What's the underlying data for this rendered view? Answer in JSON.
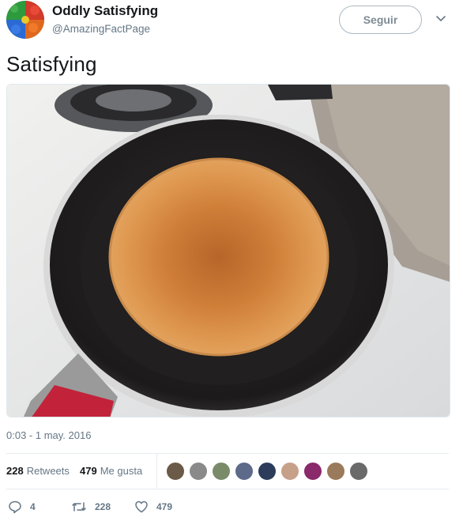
{
  "header": {
    "display_name": "Oddly Satisfying",
    "handle": "@AmazingFactPage",
    "follow_label": "Seguir",
    "avatar_icon": "colorful-candy-avatar",
    "menu_icon": "chevron-down-icon"
  },
  "tweet": {
    "text": "Satisfying",
    "media_description_icon": "pancake-in-pan-image",
    "timestamp": "0:03 - 1 may. 2016"
  },
  "stats": {
    "retweets_count": "228",
    "retweets_label": "Retweets",
    "likes_count": "479",
    "likes_label": "Me gusta",
    "liker_avatars": [
      "#6b5a48",
      "#8a8a8a",
      "#7a8b6a",
      "#5d6a8a",
      "#2c3c5a",
      "#c7a08a",
      "#8a2a6a",
      "#9a7a5a",
      "#6a6a6a"
    ]
  },
  "actions": {
    "reply_count": "4",
    "retweet_count": "228",
    "like_count": "479"
  },
  "colors": {
    "text_primary": "#14171a",
    "text_secondary": "#657786",
    "divider": "#e6ecf0"
  }
}
